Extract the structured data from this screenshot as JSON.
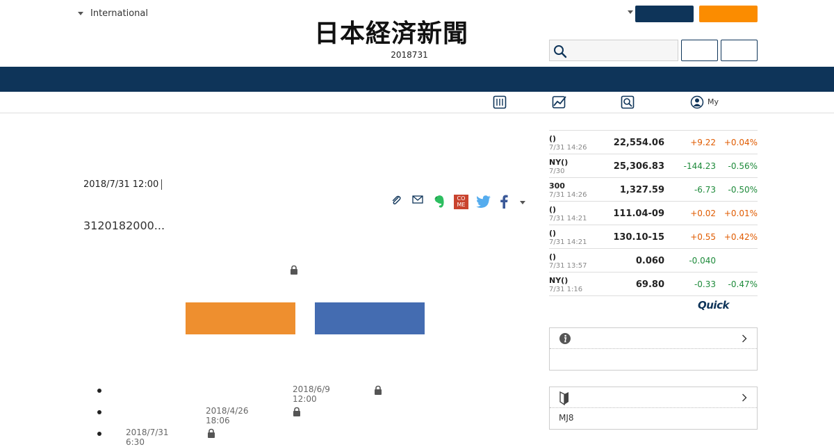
{
  "header": {
    "region_label": "International",
    "logo_text": "日本経済新聞",
    "edition_date": "2018731"
  },
  "subnav": {
    "items": [
      {
        "icon": "newspaper-icon"
      },
      {
        "icon": "chart-icon"
      },
      {
        "icon": "search-icon"
      },
      {
        "icon": "person-icon",
        "label": "My"
      }
    ]
  },
  "article": {
    "date": "2018/7/31 12:00",
    "excerpt": "3120182000...",
    "share_icons": [
      "clip-icon",
      "mail-icon",
      "evernote-icon",
      "come-icon",
      "twitter-icon",
      "facebook-icon",
      "chevron-down-icon"
    ],
    "come_label": "CO\nME"
  },
  "related": [
    {
      "date": "2018/6/9 12:00"
    },
    {
      "date": "2018/4/26 18:06"
    },
    {
      "date": "2018/7/31 6:30"
    }
  ],
  "market": {
    "rows": [
      {
        "name": "()",
        "time": "7/31 14:26",
        "value": "22,554.06",
        "change": "+9.22",
        "pct": "+0.04%",
        "dir": "up"
      },
      {
        "name": "NY()",
        "time": "7/30",
        "value": "25,306.83",
        "change": "-144.23",
        "pct": "-0.56%",
        "dir": "down"
      },
      {
        "name": "300",
        "time": "7/31 14:26",
        "value": "1,327.59",
        "change": "-6.73",
        "pct": "-0.50%",
        "dir": "down"
      },
      {
        "name": "()",
        "time": "7/31 14:21",
        "value": "111.04-09",
        "change": "+0.02",
        "pct": "+0.01%",
        "dir": "up"
      },
      {
        "name": "()",
        "time": "7/31 14:21",
        "value": "130.10-15",
        "change": "+0.55",
        "pct": "+0.42%",
        "dir": "up"
      },
      {
        "name": "()",
        "time": "7/31 13:57",
        "value": "0.060",
        "change": "-0.040",
        "pct": "",
        "dir": "down"
      },
      {
        "name": "NY()",
        "time": "7/31 1:16",
        "value": "69.80",
        "change": "-0.33",
        "pct": "-0.47%",
        "dir": "down"
      }
    ],
    "provider": "Quick"
  },
  "panels": {
    "info": {
      "icon": "info-icon"
    },
    "beginner": {
      "icon": "beginner-mark-icon",
      "body_text": "MJ8"
    }
  },
  "colors": {
    "navy": "#0e3459",
    "orange": "#fb8c00",
    "cta_orange": "#ee8f2f",
    "cta_blue": "#446cb1",
    "up": "#e05b00",
    "down": "#1d8a3a"
  }
}
